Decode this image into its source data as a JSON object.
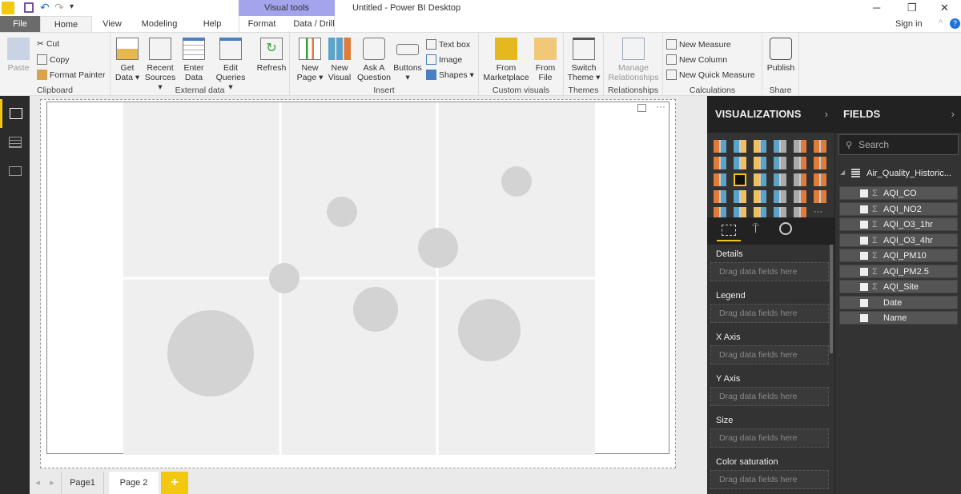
{
  "window": {
    "title": "Untitled - Power BI Desktop",
    "context_tab": "Visual tools",
    "sign_in": "Sign in"
  },
  "tabs": [
    "File",
    "Home",
    "View",
    "Modeling",
    "Help",
    "Format",
    "Data / Drill"
  ],
  "ribbon": {
    "clipboard": {
      "label": "Clipboard",
      "paste": "Paste",
      "cut": "Cut",
      "copy": "Copy",
      "format_painter": "Format Painter"
    },
    "external": {
      "label": "External data",
      "get_data": [
        "Get",
        "Data ▾"
      ],
      "recent": [
        "Recent",
        "Sources ▾"
      ],
      "enter": [
        "Enter",
        "Data"
      ],
      "edit": [
        "Edit",
        "Queries ▾"
      ],
      "refresh": "Refresh"
    },
    "insert": {
      "label": "Insert",
      "new_page": [
        "New",
        "Page ▾"
      ],
      "new_visual": [
        "New",
        "Visual"
      ],
      "ask": [
        "Ask A",
        "Question"
      ],
      "buttons": [
        "Buttons",
        "▾"
      ],
      "text_box": "Text box",
      "image": "Image",
      "shapes": "Shapes ▾"
    },
    "custom": {
      "label": "Custom visuals",
      "marketplace": [
        "From",
        "Marketplace"
      ],
      "file": [
        "From",
        "File"
      ]
    },
    "themes": {
      "label": "Themes",
      "switch": [
        "Switch",
        "Theme ▾"
      ]
    },
    "relationships": {
      "label": "Relationships",
      "manage": [
        "Manage",
        "Relationships"
      ]
    },
    "calculations": {
      "label": "Calculations",
      "new_measure": "New Measure",
      "new_column": "New Column",
      "new_quick": "New Quick Measure"
    },
    "share": {
      "label": "Share",
      "publish": "Publish"
    }
  },
  "pages": {
    "items": [
      "Page1",
      "Page 2"
    ],
    "active": "Page 2",
    "add": "+"
  },
  "visualizations": {
    "title": "VISUALIZATIONS",
    "selected": "scatter-chart",
    "wells": [
      {
        "label": "Details",
        "placeholder": "Drag data fields here"
      },
      {
        "label": "Legend",
        "placeholder": "Drag data fields here"
      },
      {
        "label": "X Axis",
        "placeholder": "Drag data fields here"
      },
      {
        "label": "Y Axis",
        "placeholder": "Drag data fields here"
      },
      {
        "label": "Size",
        "placeholder": "Drag data fields here"
      },
      {
        "label": "Color saturation",
        "placeholder": "Drag data fields here"
      }
    ]
  },
  "fields": {
    "title": "FIELDS",
    "search_placeholder": "Search",
    "table": "Air_Quality_Historic...",
    "items": [
      {
        "name": "AQI_CO",
        "sigma": "Σ"
      },
      {
        "name": "AQI_NO2",
        "sigma": "Σ"
      },
      {
        "name": "AQI_O3_1hr",
        "sigma": "Σ"
      },
      {
        "name": "AQI_O3_4hr",
        "sigma": "Σ"
      },
      {
        "name": "AQI_PM10",
        "sigma": "Σ"
      },
      {
        "name": "AQI_PM2.5",
        "sigma": "Σ"
      },
      {
        "name": "AQI_Site",
        "sigma": "Σ"
      },
      {
        "name": "Date",
        "sigma": ""
      },
      {
        "name": "Name",
        "sigma": ""
      }
    ]
  },
  "colors": {
    "accent": "#f2c811",
    "context_tab": "#a4a4ec",
    "pane": "#333333"
  }
}
